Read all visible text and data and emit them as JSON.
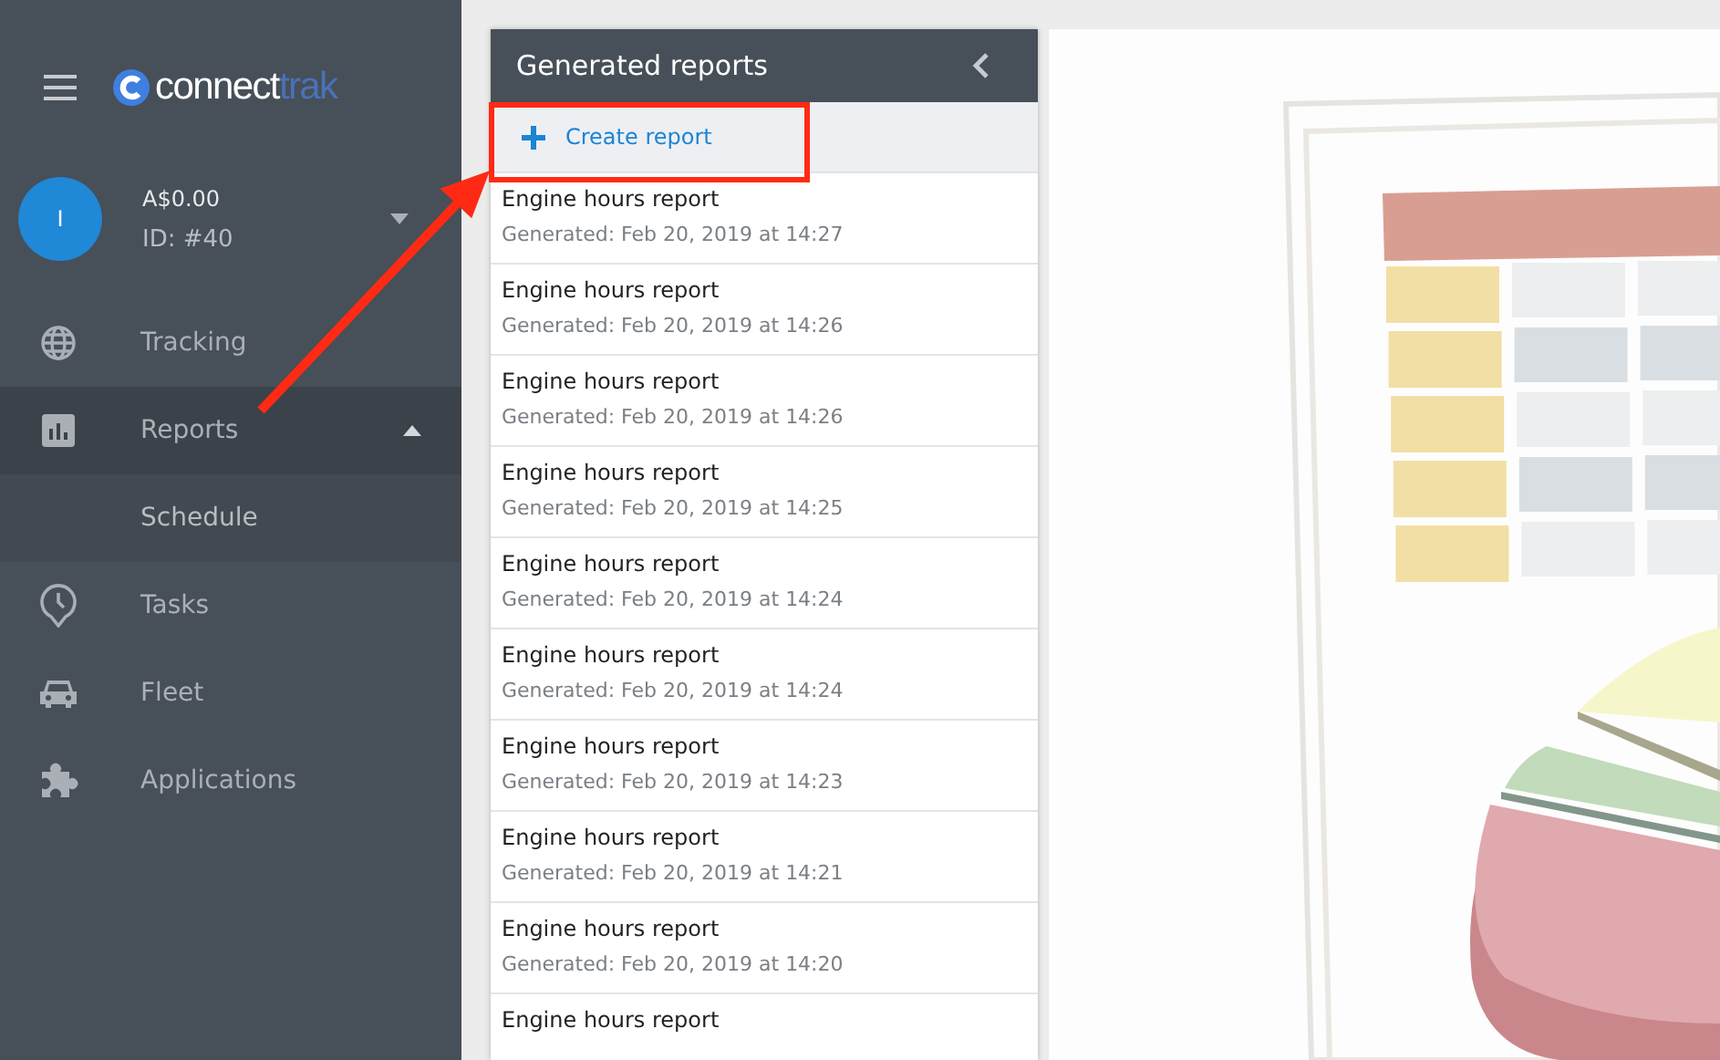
{
  "logo": {
    "first": "connect",
    "second": "trak"
  },
  "account": {
    "avatar_initial": "I",
    "balance": "A$0.00",
    "id": "ID: #40",
    "expanded": false
  },
  "nav": [
    {
      "label": "Tracking",
      "selected": false
    },
    {
      "label": "Reports",
      "selected": true,
      "expanded": true,
      "children": [
        {
          "label": "Schedule",
          "selected": false
        }
      ]
    },
    {
      "label": "Tasks",
      "selected": false
    },
    {
      "label": "Fleet",
      "selected": false
    },
    {
      "label": "Applications",
      "selected": false
    }
  ],
  "panel": {
    "title": "Generated reports",
    "create_button": "Create report",
    "reports": [
      {
        "title": "Engine hours report",
        "generated": "Generated: Feb 20, 2019 at 14:27"
      },
      {
        "title": "Engine hours report",
        "generated": "Generated: Feb 20, 2019 at 14:26"
      },
      {
        "title": "Engine hours report",
        "generated": "Generated: Feb 20, 2019 at 14:26"
      },
      {
        "title": "Engine hours report",
        "generated": "Generated: Feb 20, 2019 at 14:25"
      },
      {
        "title": "Engine hours report",
        "generated": "Generated: Feb 20, 2019 at 14:24"
      },
      {
        "title": "Engine hours report",
        "generated": "Generated: Feb 20, 2019 at 14:24"
      },
      {
        "title": "Engine hours report",
        "generated": "Generated: Feb 20, 2019 at 14:23"
      },
      {
        "title": "Engine hours report",
        "generated": "Generated: Feb 20, 2019 at 14:21"
      },
      {
        "title": "Engine hours report",
        "generated": "Generated: Feb 20, 2019 at 14:20"
      },
      {
        "title": "Engine hours report"
      }
    ]
  }
}
